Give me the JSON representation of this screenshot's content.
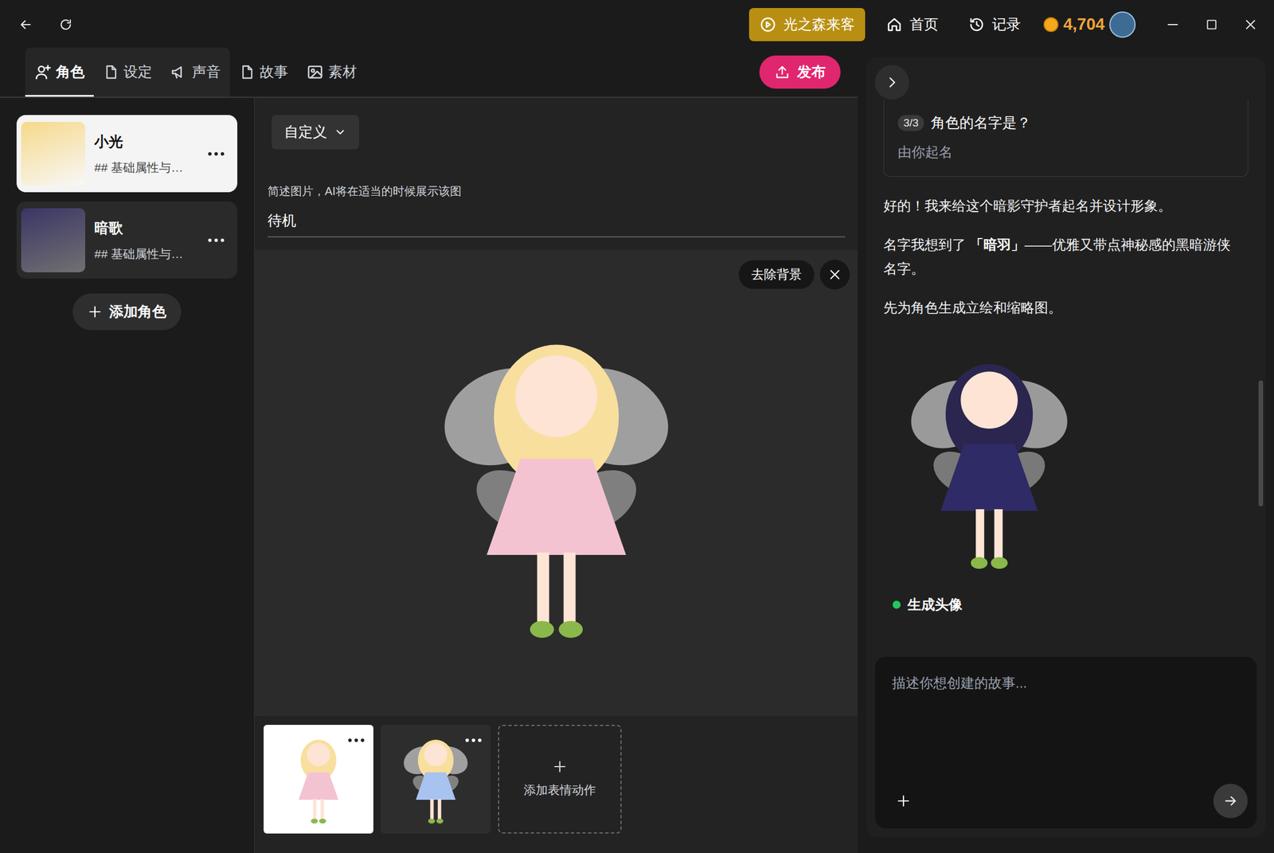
{
  "topbar": {
    "play_button": "光之森来客",
    "nav": [
      {
        "label": "首页"
      },
      {
        "label": "记录"
      }
    ],
    "coins": "4,704"
  },
  "tabs": [
    {
      "label": "角色",
      "selected": true
    },
    {
      "label": "设定",
      "selected": false
    },
    {
      "label": "声音",
      "selected": false
    },
    {
      "label": "故事",
      "selected": false
    },
    {
      "label": "素材",
      "selected": false
    }
  ],
  "publish": "发布",
  "characters": [
    {
      "name": "小光",
      "desc": "## 基础属性与…",
      "selected": true,
      "color": "#f6d98a"
    },
    {
      "name": "暗歌",
      "desc": "## 基础属性与…",
      "selected": false,
      "color": "#3b3566"
    }
  ],
  "add_character": "添加角色",
  "editor": {
    "mode": "自定义",
    "desc_label": "简述图片，AI将在适当的时候展示该图",
    "desc_value": "待机",
    "remove_bg": "去除背景",
    "thumbnails": [
      {
        "selected": true,
        "color": "#f4c3d2"
      },
      {
        "selected": false,
        "color": "#a8c3ef"
      }
    ],
    "add_expression": "添加表情动作"
  },
  "chat": {
    "question": {
      "badge": "3/3",
      "title": "角色的名字是？",
      "answer": "由你起名"
    },
    "messages": [
      [
        {
          "text": "好的！我来给这个暗影守护者起名并设计形象。",
          "bold": false
        }
      ],
      [
        {
          "text": "名字我想到了 ",
          "bold": false
        },
        {
          "text": "「暗羽」",
          "bold": true
        },
        {
          "text": "——优雅又带点神秘感的黑暗游侠名字。",
          "bold": false
        }
      ],
      [
        {
          "text": "先为角色生成立绘和缩略图。",
          "bold": false
        }
      ]
    ],
    "status": {
      "label": "生成头像",
      "color": "#22c55e"
    },
    "input": {
      "placeholder": "描述你想创建的故事..."
    }
  }
}
